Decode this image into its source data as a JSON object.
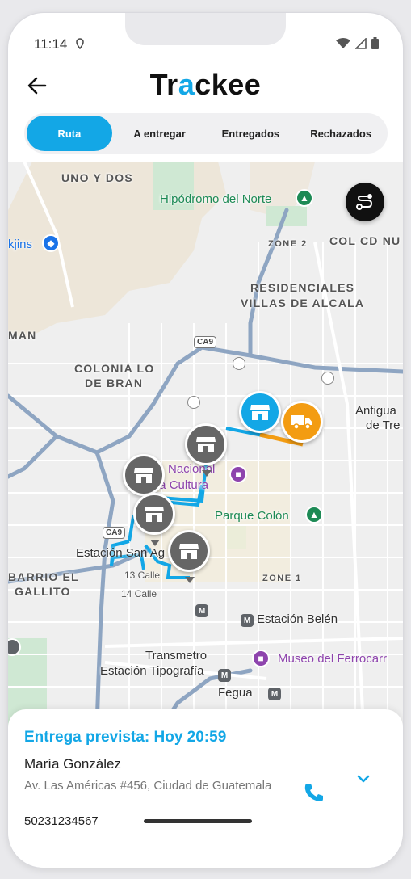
{
  "status_bar": {
    "time": "11:14",
    "icons": [
      "location-dot-icon",
      "wifi-icon",
      "signal-icon",
      "battery-icon"
    ]
  },
  "header": {
    "back_icon": "arrow-left-icon",
    "logo_part1": "Tr",
    "logo_accent": "a",
    "logo_part2": "ckee",
    "accent_color": "#13a7e6"
  },
  "tabs": [
    {
      "label": "Ruta",
      "active": true
    },
    {
      "label": "A entregar",
      "active": false
    },
    {
      "label": "Entregados",
      "active": false
    },
    {
      "label": "Rechazados",
      "active": false
    }
  ],
  "map": {
    "labels": {
      "uno_y_dos": "UNO Y DOS",
      "hipodromo": "Hipódromo del Norte",
      "zone2": "ZONE 2",
      "col_cd": "COL CD NU",
      "kjins": "kjins",
      "residenciales": "RESIDENCIALES",
      "villas": "VILLAS DE ALCALA",
      "man": "MAN",
      "colonia": "COLONIA LO",
      "de_bran": "DE BRAN",
      "antigua": "Antigua",
      "de_tre": "de Tre",
      "nacional": "Nacional",
      "cultura": "de la Cultura",
      "parque_colon": "Parque Colón",
      "estacion_san": "Estación San Ag",
      "barrio": "BARRIO EL",
      "gallito": "GALLITO",
      "calle13": "13 Calle",
      "calle14": "14 Calle",
      "zone1": "ZONE 1",
      "estacion_belen": "Estación Belén",
      "transmetro": "Transmetro",
      "estacion_tipografia": "Estación Tipografía",
      "museo": "Museo del Ferrocarr",
      "fegua": "Fegua",
      "ca9": "CA9"
    },
    "route_button_icon": "route-icon",
    "route_color": "#13a7e6",
    "active_segment_color": "#f39c12",
    "pins": [
      {
        "type": "store",
        "state": "current",
        "color": "#13a7e6"
      },
      {
        "type": "truck",
        "state": "vehicle",
        "color": "#f39c12"
      },
      {
        "type": "store",
        "state": "pending",
        "color": "#666666"
      },
      {
        "type": "store",
        "state": "pending",
        "color": "#666666"
      },
      {
        "type": "store",
        "state": "pending",
        "color": "#666666"
      },
      {
        "type": "store",
        "state": "pending",
        "color": "#666666"
      }
    ]
  },
  "delivery": {
    "eta": "Entrega prevista: Hoy 20:59",
    "customer": "María González",
    "address": "Av. Las Américas #456, Ciudad de Guatemala",
    "phone": "50231234567",
    "call_icon": "phone-icon",
    "expand_icon": "chevron-down-icon"
  }
}
